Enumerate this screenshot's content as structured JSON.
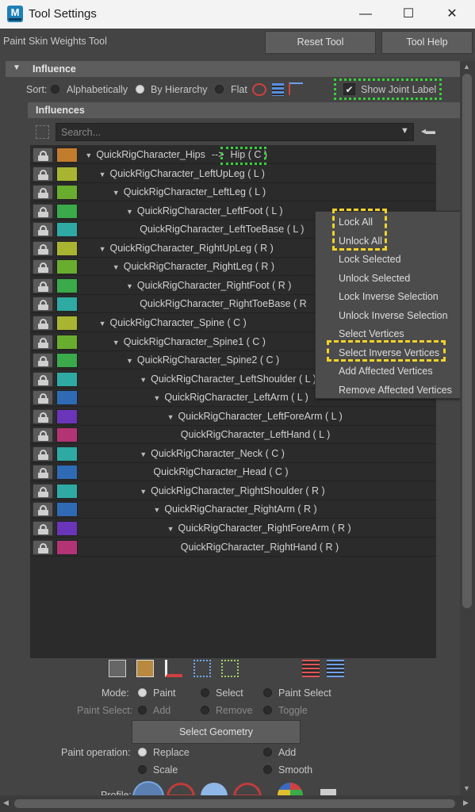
{
  "window": {
    "title": "Tool Settings",
    "app_icon_letter": "M",
    "minimize": "—",
    "maximize": "☐",
    "close": "✕"
  },
  "tool": {
    "name": "Paint Skin Weights Tool",
    "reset_label": "Reset Tool",
    "help_label": "Tool Help"
  },
  "influence": {
    "section_label": "Influence",
    "sort_label": "Sort:",
    "sort_options": [
      "Alphabetically",
      "By Hierarchy",
      "Flat"
    ],
    "show_joint_label": "Show Joint Label",
    "influences_label": "Influences",
    "search_placeholder": "Search...",
    "joints": [
      {
        "name": "QuickRigCharacter_Hips",
        "suffix": "-->",
        "label": "Hip ( C )",
        "color": "#c27c2e"
      },
      {
        "name": "QuickRigCharacter_LeftUpLeg ( L )",
        "color": "#a9b531"
      },
      {
        "name": "QuickRigCharacter_LeftLeg ( L )",
        "color": "#69ad2f"
      },
      {
        "name": "QuickRigCharacter_LeftFoot ( L )",
        "color": "#3aaa4a"
      },
      {
        "name": "QuickRigCharacter_LeftToeBase ( L )",
        "color": "#2eaaa3"
      },
      {
        "name": "QuickRigCharacter_RightUpLeg ( R )",
        "color": "#a9b531"
      },
      {
        "name": "QuickRigCharacter_RightLeg ( R )",
        "color": "#69ad2f"
      },
      {
        "name": "QuickRigCharacter_RightFoot ( R )",
        "color": "#3aaa4a"
      },
      {
        "name": "QuickRigCharacter_RightToeBase ( R",
        "color": "#2eaaa3"
      },
      {
        "name": "QuickRigCharacter_Spine ( C )",
        "color": "#a9b531"
      },
      {
        "name": "QuickRigCharacter_Spine1 ( C )",
        "color": "#69ad2f"
      },
      {
        "name": "QuickRigCharacter_Spine2 ( C )",
        "color": "#3aaa4a"
      },
      {
        "name": "QuickRigCharacter_LeftShoulder ( L )",
        "color": "#2eaaa3"
      },
      {
        "name": "QuickRigCharacter_LeftArm ( L )",
        "color": "#2f6ab5"
      },
      {
        "name": "QuickRigCharacter_LeftForeArm ( L )",
        "color": "#6a35b8"
      },
      {
        "name": "QuickRigCharacter_LeftHand ( L )",
        "color": "#b23475"
      },
      {
        "name": "QuickRigCharacter_Neck ( C )",
        "color": "#2eaaa3"
      },
      {
        "name": "QuickRigCharacter_Head ( C )",
        "color": "#2f6ab5"
      },
      {
        "name": "QuickRigCharacter_RightShoulder ( R )",
        "color": "#2eaaa3"
      },
      {
        "name": "QuickRigCharacter_RightArm ( R )",
        "color": "#2f6ab5"
      },
      {
        "name": "QuickRigCharacter_RightForeArm ( R )",
        "color": "#6a35b8"
      },
      {
        "name": "QuickRigCharacter_RightHand ( R )",
        "color": "#b23475"
      }
    ]
  },
  "context_menu": {
    "items": [
      "Lock All",
      "Unlock All",
      "Lock Selected",
      "Unlock Selected",
      "Lock Inverse Selection",
      "Unlock Inverse Selection",
      "Select Vertices",
      "Select Inverse Vertices",
      "Add Affected Vertices",
      "Remove Affected Vertices"
    ]
  },
  "options": {
    "mode_label": "Mode:",
    "mode_options": [
      "Paint",
      "Select",
      "Paint Select"
    ],
    "paint_select_label": "Paint Select:",
    "paint_select_options": [
      "Add",
      "Remove",
      "Toggle"
    ],
    "select_geometry_label": "Select Geometry",
    "paint_operation_label": "Paint operation:",
    "paint_operation_options": [
      "Replace",
      "Add",
      "Scale",
      "Smooth"
    ],
    "profile_label": "Profile:"
  },
  "colors": {
    "highlight_green": "#39d13a",
    "highlight_yellow": "#f2d22a"
  }
}
